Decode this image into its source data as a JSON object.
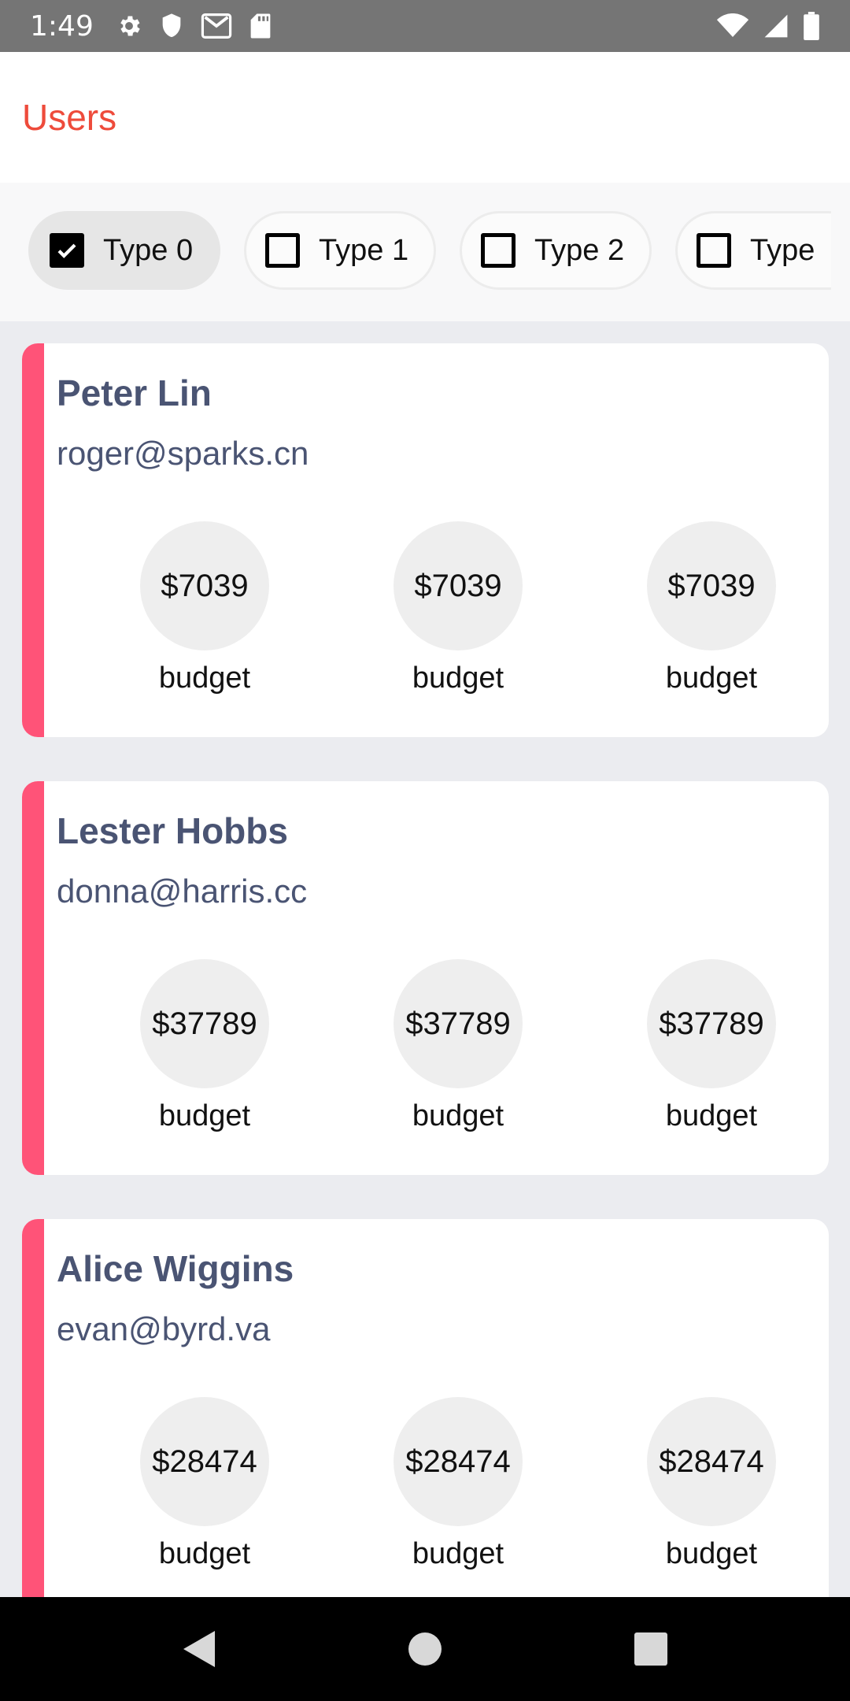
{
  "status_bar": {
    "time": "1:49",
    "icons_left": [
      "gear-icon",
      "shield-icon",
      "gmail-icon",
      "sd-card-icon"
    ],
    "icons_right": [
      "wifi-icon",
      "signal-icon",
      "battery-icon"
    ]
  },
  "app_bar": {
    "title": "Users",
    "title_color": "#ee4b3b"
  },
  "filters": [
    {
      "label": "Type 0",
      "checked": true
    },
    {
      "label": "Type 1",
      "checked": false
    },
    {
      "label": "Type 2",
      "checked": false
    },
    {
      "label": "Type",
      "checked": false
    }
  ],
  "accent_color": "#ff5378",
  "users": [
    {
      "name": "Peter Lin",
      "email": "roger@sparks.cn",
      "stats": [
        {
          "value": "$7039",
          "label": "budget"
        },
        {
          "value": "$7039",
          "label": "budget"
        },
        {
          "value": "$7039",
          "label": "budget"
        }
      ]
    },
    {
      "name": "Lester Hobbs",
      "email": "donna@harris.cc",
      "stats": [
        {
          "value": "$37789",
          "label": "budget"
        },
        {
          "value": "$37789",
          "label": "budget"
        },
        {
          "value": "$37789",
          "label": "budget"
        }
      ]
    },
    {
      "name": "Alice Wiggins",
      "email": "evan@byrd.va",
      "stats": [
        {
          "value": "$28474",
          "label": "budget"
        },
        {
          "value": "$28474",
          "label": "budget"
        },
        {
          "value": "$28474",
          "label": "budget"
        }
      ]
    }
  ],
  "nav_bar": {
    "buttons": [
      "back-icon",
      "home-icon",
      "recents-icon"
    ]
  }
}
